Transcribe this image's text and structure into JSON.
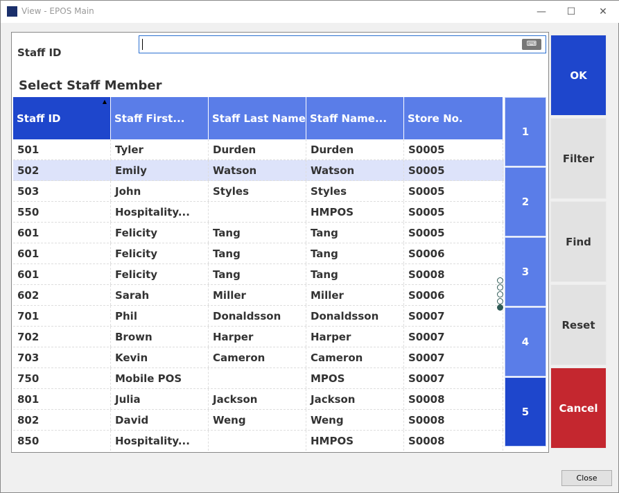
{
  "window": {
    "title": "View - EPOS Main",
    "minimize": "—",
    "maximize": "☐",
    "close": "✕"
  },
  "staff_id": {
    "label": "Staff ID",
    "value": "",
    "keyboard_icon": "keyboard-icon"
  },
  "heading": "Select Staff Member",
  "table": {
    "columns": [
      "Staff ID",
      "Staff First...",
      "Staff Last Name",
      "Staff Name...",
      "Store No."
    ],
    "rows": [
      [
        "501",
        "Tyler",
        "Durden",
        "Durden",
        "S0005"
      ],
      [
        "502",
        "Emily",
        "Watson",
        "Watson",
        "S0005"
      ],
      [
        "503",
        "John",
        "Styles",
        "Styles",
        "S0005"
      ],
      [
        "550",
        "Hospitality...",
        "",
        "HMPOS",
        "S0005"
      ],
      [
        "601",
        "Felicity",
        "Tang",
        "Tang",
        "S0005"
      ],
      [
        "601",
        "Felicity",
        "Tang",
        "Tang",
        "S0006"
      ],
      [
        "601",
        "Felicity",
        "Tang",
        "Tang",
        "S0008"
      ],
      [
        "602",
        "Sarah",
        "Miller",
        "Miller",
        "S0006"
      ],
      [
        "701",
        "Phil",
        "Donaldsson",
        "Donaldsson",
        "S0007"
      ],
      [
        "702",
        "Brown",
        "Harper",
        "Harper",
        "S0007"
      ],
      [
        "703",
        "Kevin",
        "Cameron",
        "Cameron",
        "S0007"
      ],
      [
        "750",
        "Mobile POS",
        "",
        "MPOS",
        "S0007"
      ],
      [
        "801",
        "Julia",
        "Jackson",
        "Jackson",
        "S0008"
      ],
      [
        "802",
        "David",
        "Weng",
        "Weng",
        "S0008"
      ],
      [
        "850",
        "Hospitality...",
        "",
        "HMPOS",
        "S0008"
      ]
    ],
    "selected_row": 1
  },
  "pages": [
    "1",
    "2",
    "3",
    "4",
    "5"
  ],
  "active_page": 5,
  "buttons": {
    "ok": "OK",
    "filter": "Filter",
    "find": "Find",
    "reset": "Reset",
    "cancel": "Cancel",
    "close": "Close"
  },
  "colors": {
    "accent": "#1e46cc",
    "header": "#5a7de8",
    "cancel": "#c4272f"
  }
}
